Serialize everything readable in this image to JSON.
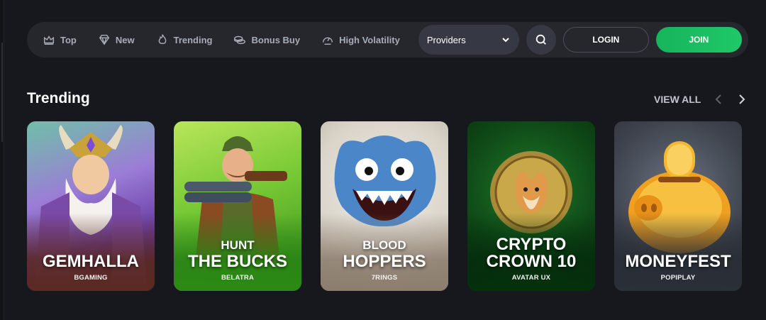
{
  "nav": {
    "items": [
      {
        "label": "Top",
        "icon": "crown-icon"
      },
      {
        "label": "New",
        "icon": "diamond-icon"
      },
      {
        "label": "Trending",
        "icon": "flame-icon"
      },
      {
        "label": "Bonus Buy",
        "icon": "coins-icon"
      },
      {
        "label": "High Volatility",
        "icon": "gauge-icon"
      }
    ],
    "providers_label": "Providers",
    "login_label": "LOGIN",
    "join_label": "JOIN"
  },
  "section": {
    "title": "Trending",
    "view_all": "VIEW ALL"
  },
  "games": [
    {
      "title_small": "",
      "title_big": "GEMHALLA",
      "provider": "BGAMING"
    },
    {
      "title_small": "HUNT",
      "title_big": "THE BUCKS",
      "provider": "BELATRA"
    },
    {
      "title_small": "BLOOD",
      "title_big": "HOPPERS",
      "provider": "7RINGS"
    },
    {
      "title_small": "CRYPTO",
      "title_big": "CROWN 10",
      "provider": "AVATAR UX"
    },
    {
      "title_small": "",
      "title_big": "MONEYFEST",
      "provider": "POPIPLAY"
    }
  ],
  "colors": {
    "background": "#16181d",
    "navbar": "#25272d",
    "join": "#1fc868"
  }
}
